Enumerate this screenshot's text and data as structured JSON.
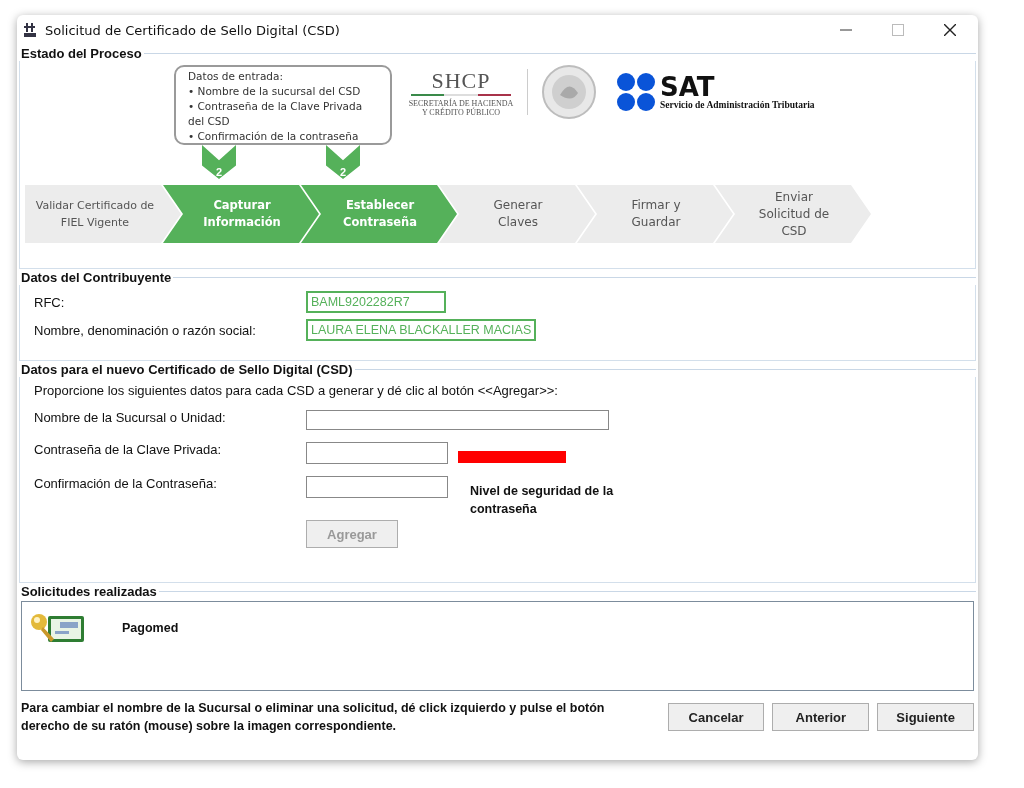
{
  "window": {
    "title": "Solicitud de Certificado de Sello Digital (CSD)"
  },
  "process": {
    "legend": "Estado del Proceso",
    "callout": {
      "heading": "Datos de entrada:",
      "items": [
        "• Nombre de la sucursal del CSD",
        "• Contraseña de la Clave Privada del CSD",
        "• Confirmación de la contraseña"
      ]
    },
    "markers": [
      "2",
      "2"
    ],
    "logos": {
      "shcp": "SHCP",
      "shcp_sub": "SECRETARÍA DE HACIENDA Y CRÉDITO PÚBLICO",
      "sat": "SAT",
      "sat_sub": "Servicio de Administración Tributaria"
    },
    "steps": [
      {
        "label": "Validar Certificado de FIEL Vigente",
        "active": false
      },
      {
        "label": "Capturar Información",
        "active": true
      },
      {
        "label": "Establecer Contraseña",
        "active": true
      },
      {
        "label": "Generar Claves",
        "active": false
      },
      {
        "label": "Firmar y Guardar",
        "active": false
      },
      {
        "label": "Enviar Solicitud de CSD",
        "active": false
      }
    ]
  },
  "taxpayer": {
    "legend": "Datos del Contribuyente",
    "fields": [
      {
        "label": "RFC:",
        "value": "BAML9202282R7"
      },
      {
        "label": "Nombre, denominación o razón social:",
        "value": "LAURA ELENA BLACKALLER MACIAS"
      }
    ]
  },
  "csd": {
    "legend": "Datos para el nuevo Certificado de Sello Digital (CSD)",
    "instructions": "Proporcione los siguientes datos para cada CSD a generar y dé clic al botón <<Agregar>>:",
    "branch_label": "Nombre de la Sucursal o Unidad:",
    "password_label": "Contraseña de la Clave Privada:",
    "confirm_label": "Confirmación de la Contraseña:",
    "strength": {
      "level": 1,
      "caption": "Nivel de seguridad de la contraseña"
    },
    "add_button": {
      "label": "Agregar",
      "disabled": true
    }
  },
  "requests": {
    "legend": "Solicitudes realizadas",
    "items": [
      {
        "name": "Pagomed"
      }
    ]
  },
  "footer": {
    "hint": "Para cambiar el nombre de la Sucursal o eliminar una solicitud, dé click izquierdo y pulse el botón derecho de su ratón (mouse) sobre la imagen correspondiente.",
    "buttons": [
      "Cancelar",
      "Anterior",
      "Siguiente"
    ]
  }
}
